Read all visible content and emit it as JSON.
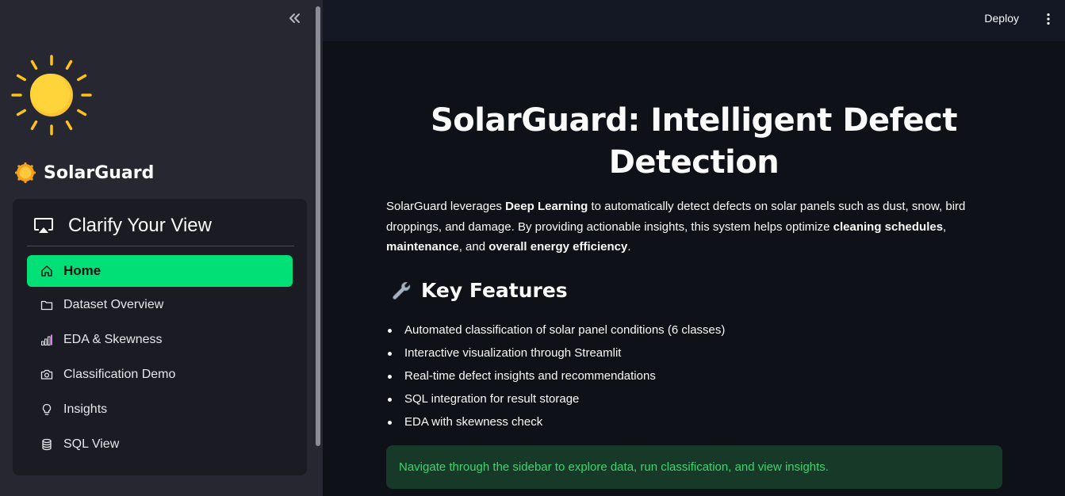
{
  "sidebar": {
    "brand": {
      "emoji": "🌞",
      "title": "SolarGuard"
    },
    "menu": {
      "title": "Clarify Your View",
      "icon": "airplay-icon",
      "accent_color": "#00e077",
      "items": [
        {
          "label": "Home",
          "icon": "house-icon",
          "active": true
        },
        {
          "label": "Dataset Overview",
          "icon": "folder-icon",
          "active": false
        },
        {
          "label": "EDA & Skewness",
          "icon": "bar-chart-icon",
          "active": false
        },
        {
          "label": "Classification Demo",
          "icon": "camera-icon",
          "active": false
        },
        {
          "label": "Insights",
          "icon": "lightbulb-icon",
          "active": false
        },
        {
          "label": "SQL View",
          "icon": "database-icon",
          "active": false
        }
      ]
    }
  },
  "header": {
    "deploy_label": "Deploy"
  },
  "main": {
    "title": "SolarGuard: Intelligent Defect Detection",
    "intro": {
      "t1": "SolarGuard leverages ",
      "b1": "Deep Learning",
      "t2": " to automatically detect defects on solar panels such as dust, snow, bird droppings, and damage. By providing actionable insights, this system helps optimize ",
      "b2": "cleaning schedules",
      "t3": ", ",
      "b3": "maintenance",
      "t4": ", and ",
      "b4": "overall energy efficiency",
      "t5": "."
    },
    "features": {
      "emoji": "🔧",
      "title": "Key Features",
      "items": [
        "Automated classification of solar panel conditions (6 classes)",
        "Interactive visualization through Streamlit",
        "Real-time defect insights and recommendations",
        "SQL integration for result storage",
        "EDA with skewness check"
      ]
    },
    "success_message": "Navigate through the sidebar to explore data, run classification, and view insights."
  }
}
